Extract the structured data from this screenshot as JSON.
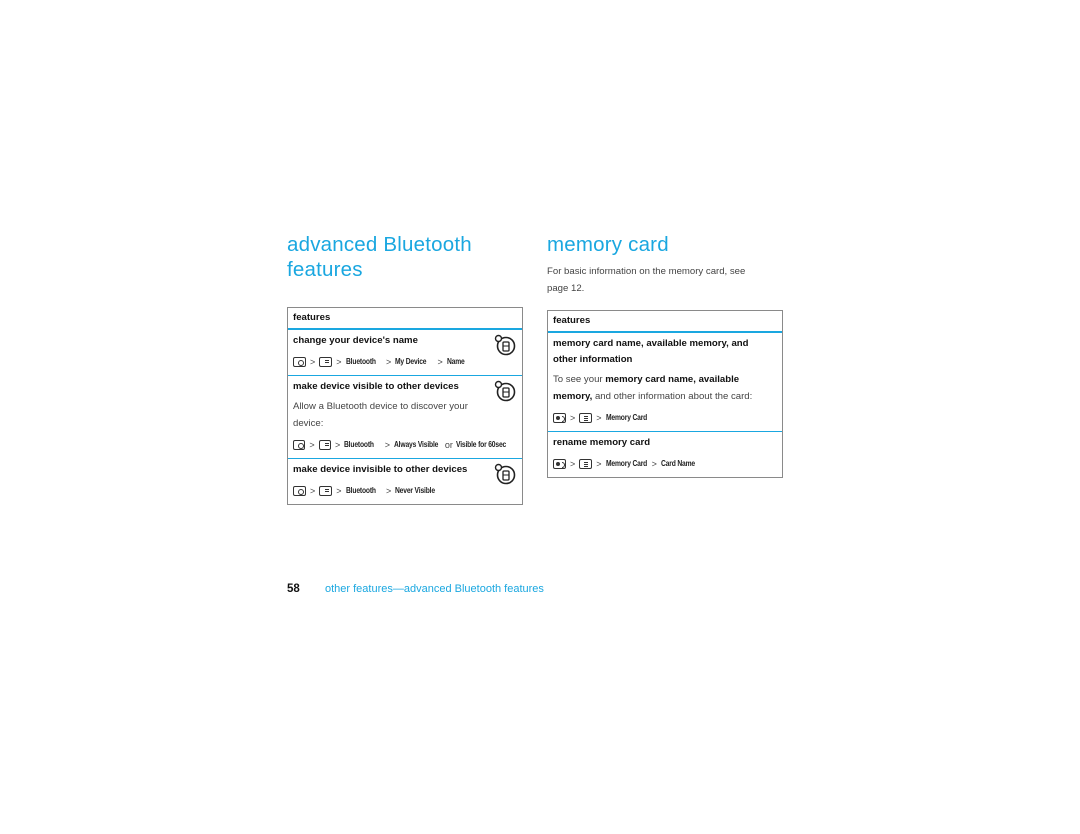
{
  "left": {
    "title_line1": "advanced Bluetooth",
    "title_line2": "features",
    "table": {
      "header": "features",
      "rows": [
        {
          "title": "change your device's name",
          "icon": "network-feature-icon",
          "path": {
            "key1": "nav-key-icon",
            "key2": "menu-key-icon",
            "items": [
              "Bluetooth",
              "My Device",
              "Name"
            ]
          }
        },
        {
          "title": "make device visible to other devices",
          "description": "Allow a Bluetooth device to discover your device:",
          "icon": "network-feature-icon",
          "path": {
            "key1": "nav-key-icon",
            "key2": "menu-key-icon",
            "items": [
              "Bluetooth"
            ],
            "option_a": "Always Visible",
            "or": "or",
            "option_b": "Visible for 60sec"
          }
        },
        {
          "title": "make device invisible to other devices",
          "icon": "network-feature-icon",
          "path": {
            "key1": "nav-key-icon",
            "key2": "menu-key-icon",
            "items": [
              "Bluetooth",
              "Never Visible"
            ]
          }
        }
      ]
    }
  },
  "right": {
    "title": "memory card",
    "intro": "For basic information on the memory card, see page 12.",
    "table": {
      "header": "features",
      "rows": [
        {
          "title": "memory card name, available memory, and other information",
          "desc_prefix": "To see your ",
          "desc_bold": "memory card name, available memory,",
          "desc_suffix": " and other information about the card:",
          "path": {
            "key1": "media-key-icon",
            "key2": "list-key-icon",
            "items": [
              "Memory Card"
            ]
          }
        },
        {
          "title": "rename memory card",
          "path": {
            "key1": "media-key-icon",
            "key2": "list-key-icon",
            "item1": "Memory Card",
            "item2": "Card Name"
          }
        }
      ]
    }
  },
  "footer": {
    "page_number": "58",
    "section": "other features—advanced Bluetooth features"
  },
  "separator": ">",
  "colors": {
    "accent": "#1aa7e0",
    "border": "#8a8a8a"
  }
}
